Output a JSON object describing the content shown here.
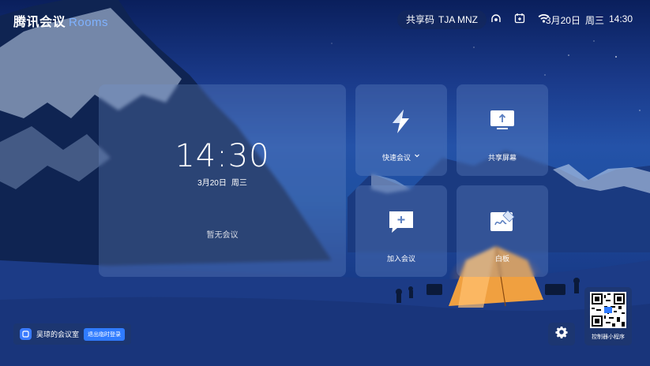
{
  "brand": {
    "name_cn": "腾讯会议",
    "name_en": "Rooms"
  },
  "header": {
    "share_code_label": "共享码",
    "share_code_value": "TJA MNZ",
    "date": "3月20日",
    "weekday": "周三",
    "time": "14:30",
    "icons": [
      "headset-icon",
      "calendar-icon",
      "wifi-icon"
    ]
  },
  "clock": {
    "time": "14:30",
    "date": "3月20日",
    "weekday": "周三",
    "no_meeting": "暂无会议"
  },
  "tiles": {
    "quick": {
      "label": "快速会议",
      "icon": "lightning-icon"
    },
    "share": {
      "label": "共享屏幕",
      "icon": "share-screen-icon"
    },
    "join": {
      "label": "加入会议",
      "icon": "join-meeting-icon"
    },
    "board": {
      "label": "白板",
      "icon": "whiteboard-icon"
    }
  },
  "room": {
    "name": "吴琼的会议室",
    "exit_label": "退出临时登录"
  },
  "qr": {
    "label": "控制器小程序"
  },
  "colors": {
    "accent": "#2f7bff",
    "brand_light": "#7fb2ff"
  }
}
